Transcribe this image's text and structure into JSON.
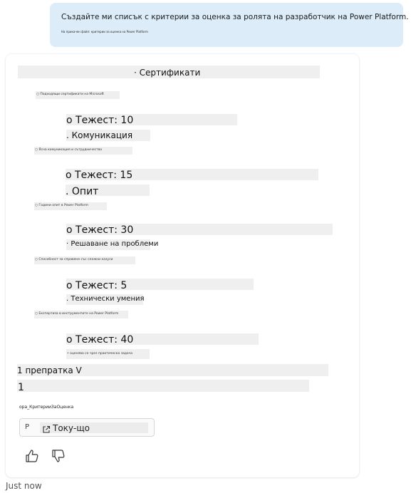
{
  "user_message": {
    "text": "Създайте ми списък с критерии за оценка за ролята на разработчик на Power Platform.",
    "attachment_label": "На прикачен файл: критерии за оценка на Power Platform"
  },
  "response": {
    "heading": "· Сертификати",
    "certificates_note": "○ Подходящи сертификати на Microsoft",
    "weight_certs": "o Тежест: 10",
    "communication": ". Комуникация",
    "communication_note": "○ Ясна комуникация и сътрудничество",
    "weight_communication": "o Тежест: 15",
    "experience": ". Опит",
    "experience_note": "○ Години опит в Power Platform",
    "weight_experience": "o Тежест: 30",
    "problem_solving": "· Решаване на проблеми",
    "problem_solving_note": "○ Способност за справяне със сложни казуси",
    "weight_problem_solving": "o Тежест: 5",
    "tech_skills": ". Технически умения",
    "tech_skills_note": "○ Експертиза в инструментите на Power Platform",
    "weight_tech_skills": "o Тежест: 40",
    "weight_tech_note": "• оценява се чрез практическа задача",
    "references_label": "1 препратка V",
    "reference_number": "1",
    "reference_file": "ора_КритерииЗаОценка",
    "reference_letter": "P",
    "reference_time": "Току-що"
  },
  "timestamp": "Just now",
  "icons": {
    "external": "external-link-icon",
    "like": "thumbs-up-icon",
    "dislike": "thumbs-down-icon"
  }
}
